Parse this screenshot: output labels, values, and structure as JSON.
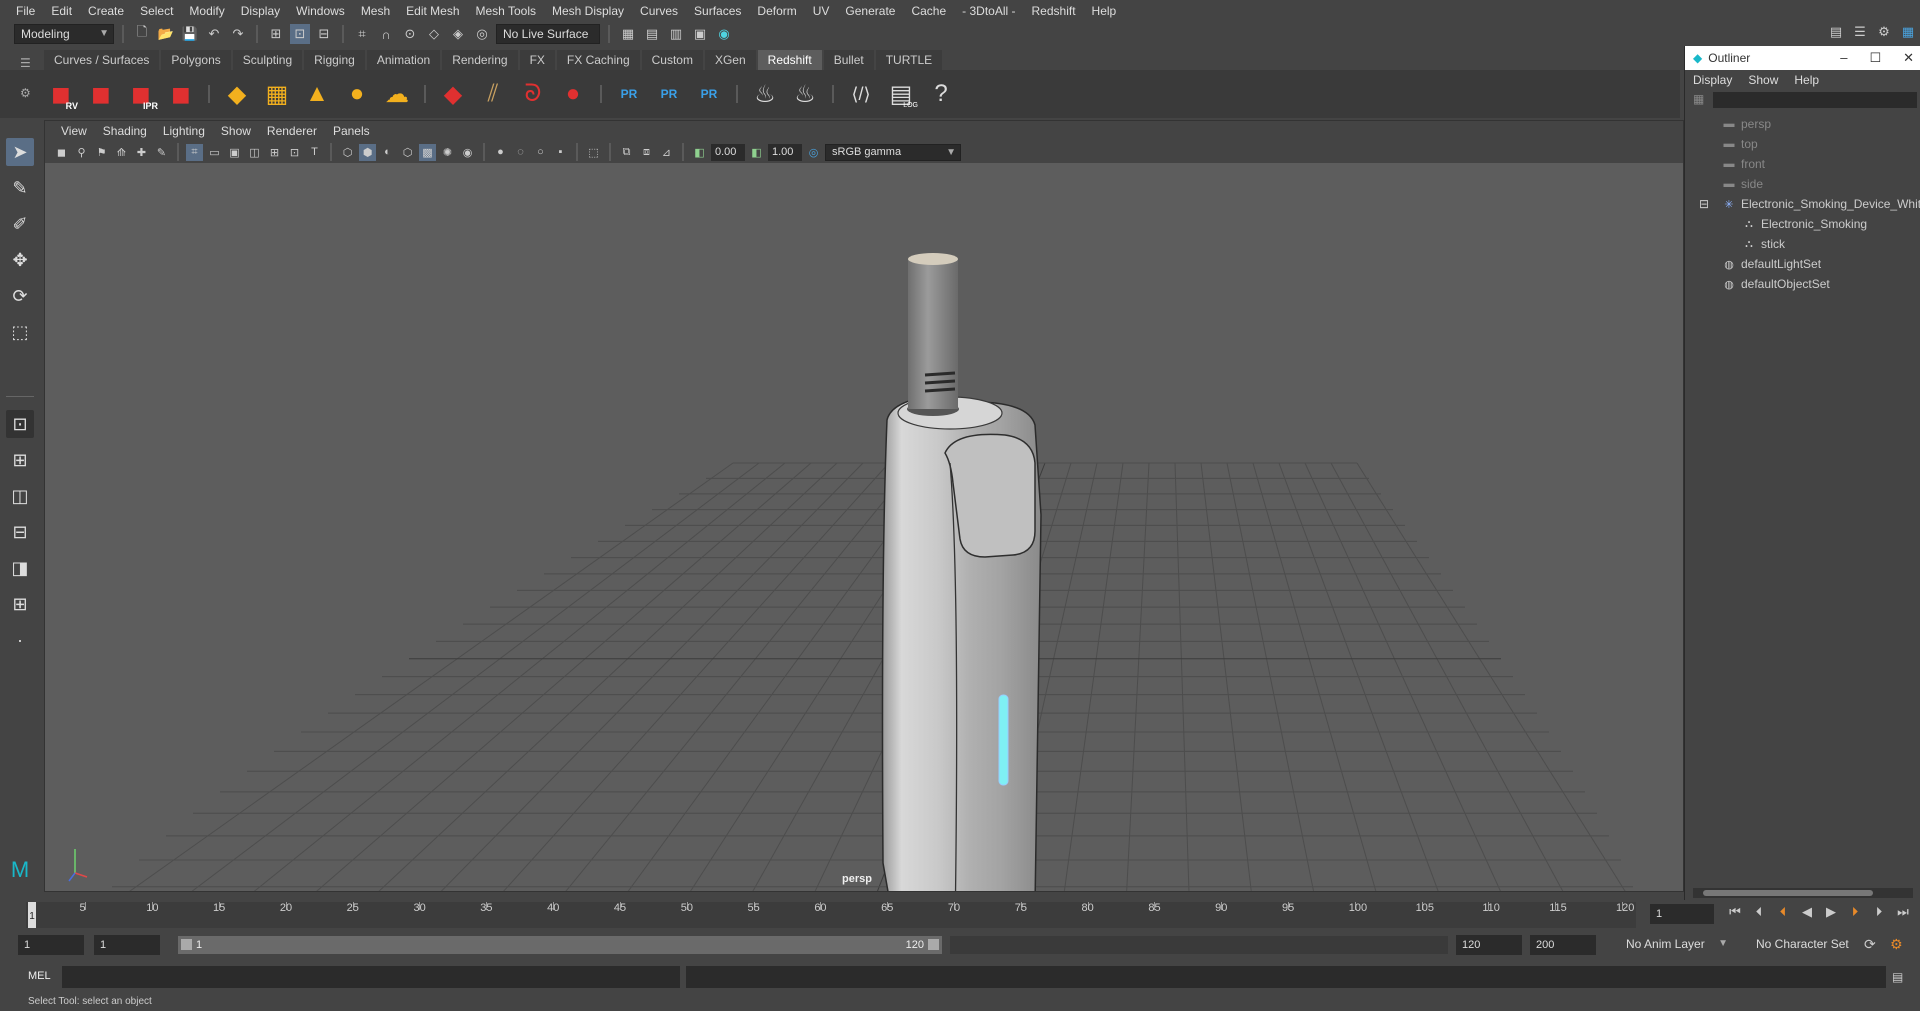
{
  "menubar": {
    "items": [
      "File",
      "Edit",
      "Create",
      "Select",
      "Modify",
      "Display",
      "Windows",
      "Mesh",
      "Edit Mesh",
      "Mesh Tools",
      "Mesh Display",
      "Curves",
      "Surfaces",
      "Deform",
      "UV",
      "Generate",
      "Cache",
      "- 3DtoAll -",
      "Redshift",
      "Help"
    ]
  },
  "statusline": {
    "menuset": "Modeling",
    "live_surface": "No Live Surface"
  },
  "shelf": {
    "tabs": [
      "Curves / Surfaces",
      "Polygons",
      "Sculpting",
      "Rigging",
      "Animation",
      "Rendering",
      "FX",
      "FX Caching",
      "Custom",
      "XGen",
      "Redshift",
      "Bullet",
      "TURTLE"
    ],
    "active_tab": "Redshift",
    "rv_label": "RV",
    "ipr_label": "IPR",
    "pr_label": "PR",
    "log_label": "LOG"
  },
  "viewport": {
    "menu": [
      "View",
      "Shading",
      "Lighting",
      "Show",
      "Renderer",
      "Panels"
    ],
    "exposure": "0.00",
    "gamma": "1.00",
    "color_space": "sRGB gamma",
    "camera": "persp"
  },
  "outliner": {
    "title": "Outliner",
    "menu": [
      "Display",
      "Show",
      "Help"
    ],
    "items": [
      {
        "label": "persp",
        "indent": 0,
        "dim": true,
        "icon": "camera-icon"
      },
      {
        "label": "top",
        "indent": 0,
        "dim": true,
        "icon": "camera-icon"
      },
      {
        "label": "front",
        "indent": 0,
        "dim": true,
        "icon": "camera-icon"
      },
      {
        "label": "side",
        "indent": 0,
        "dim": true,
        "icon": "camera-icon"
      },
      {
        "label": "Electronic_Smoking_Device_White",
        "indent": 0,
        "dim": false,
        "icon": "group-icon"
      },
      {
        "label": "Electronic_Smoking",
        "indent": 1,
        "dim": false,
        "icon": "mesh-icon"
      },
      {
        "label": "stick",
        "indent": 1,
        "dim": false,
        "icon": "mesh-icon"
      },
      {
        "label": "defaultLightSet",
        "indent": 0,
        "dim": false,
        "icon": "set-icon"
      },
      {
        "label": "defaultObjectSet",
        "indent": 0,
        "dim": false,
        "icon": "set-icon"
      }
    ]
  },
  "timeslider": {
    "ticks": [
      1,
      5,
      10,
      15,
      20,
      25,
      30,
      35,
      40,
      45,
      50,
      55,
      60,
      65,
      70,
      75,
      80,
      85,
      90,
      95,
      100,
      105,
      110,
      115,
      120
    ],
    "current_frame": "1",
    "start": 1,
    "end": 120
  },
  "range": {
    "start_time": "1",
    "playback_start": "1",
    "range_start": "1",
    "range_end": "120",
    "playback_end": "120",
    "end_time": "200",
    "anim_layer": "No Anim Layer",
    "character_set": "No Character Set"
  },
  "cmdline": {
    "mel_label": "MEL"
  },
  "helpline": {
    "text": "Select Tool: select an object"
  }
}
